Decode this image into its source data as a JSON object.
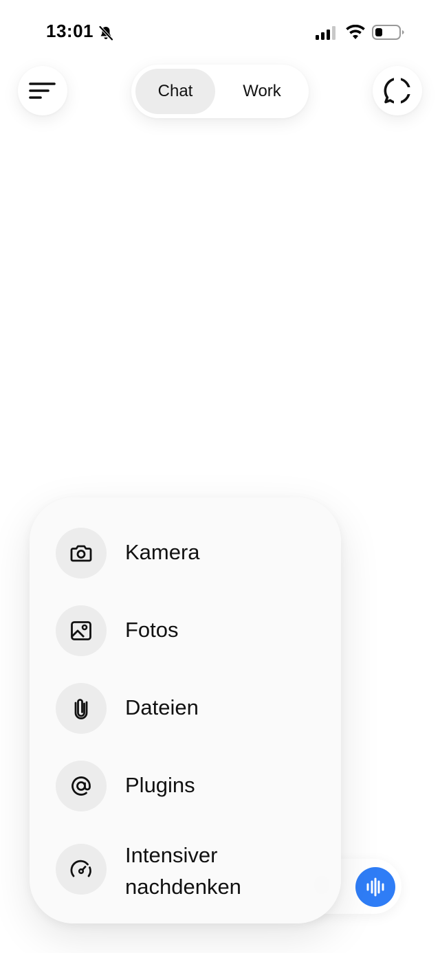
{
  "status_bar": {
    "time": "13:01",
    "icons": [
      "bell-slash-icon",
      "cellular-signal-icon",
      "wifi-icon",
      "battery-icon"
    ]
  },
  "header": {
    "menu_icon": "menu-icon",
    "tabs": [
      {
        "label": "Chat",
        "selected": true
      },
      {
        "label": "Work",
        "selected": false
      }
    ],
    "new_chat_icon": "chat-bubble-icon"
  },
  "attach_menu": {
    "items": [
      {
        "label": "Kamera",
        "icon": "camera-icon"
      },
      {
        "label": "Fotos",
        "icon": "photo-icon"
      },
      {
        "label": "Dateien",
        "icon": "paperclip-icon"
      },
      {
        "label": "Plugins",
        "icon": "at-sign-icon"
      },
      {
        "label": "Intensiver\nnachdenken",
        "icon": "gauge-icon"
      }
    ]
  },
  "composer": {
    "voice_icon": "voice-waveform-icon"
  },
  "colors": {
    "accent": "#2f7df6",
    "menu_background": "#fafafa",
    "icon_circle": "#ececec",
    "segment_active": "#ececec"
  }
}
